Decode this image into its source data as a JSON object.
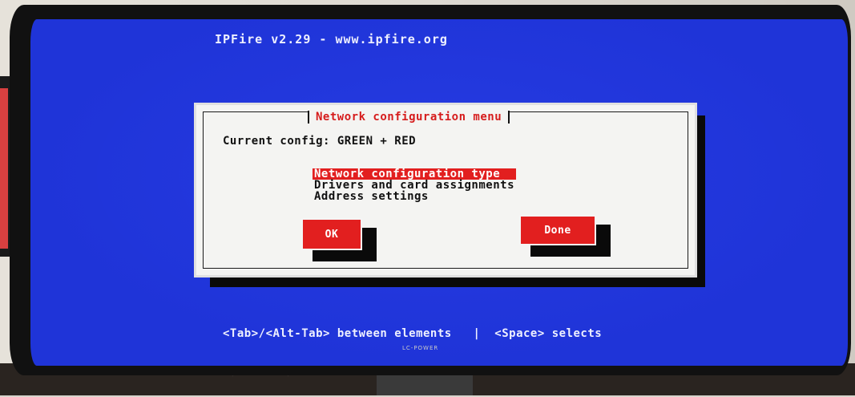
{
  "screen": {
    "title": "IPFire v2.29 - www.ipfire.org",
    "footer": "<Tab>/<Alt-Tab> between elements   |  <Space> selects"
  },
  "dialog": {
    "title": "Network configuration menu",
    "current_config": "Current config: GREEN + RED",
    "menu_items": [
      "Network configuration type",
      "Drivers and card assignments",
      "Address settings"
    ],
    "selected_index": 0,
    "ok_label": "OK",
    "done_label": "Done"
  },
  "monitor": {
    "brand": "LC-POWER"
  },
  "colors": {
    "screen_bg": "#1f34d8",
    "dialog_bg": "#f4f4f2",
    "accent_red": "#e21f1f"
  }
}
